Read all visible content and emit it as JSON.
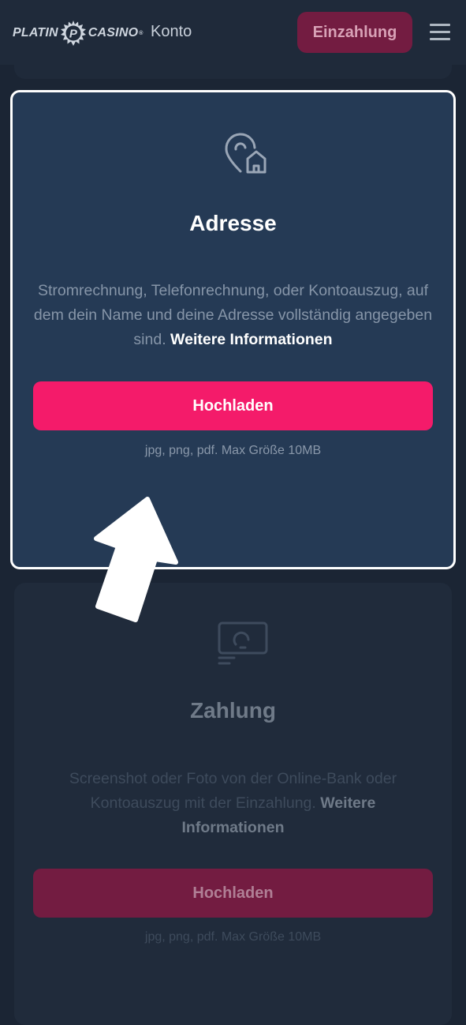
{
  "header": {
    "logo_left": "PLATIN",
    "logo_emblem_letter": "P",
    "logo_right": "CASINO",
    "logo_tm": "®",
    "nav_konto": "Konto",
    "deposit_button": "Einzahlung",
    "menu_icon": "hamburger-menu-icon"
  },
  "cards": {
    "adresse": {
      "icon": "location-home-icon",
      "title": "Adresse",
      "description": "Stromrechnung, Telefonrechnung, oder Kontoauszug, auf dem dein Name und deine Adresse vollständig angegeben sind.",
      "more_link": "Weitere Informationen",
      "upload_button": "Hochladen",
      "note": "jpg, png, pdf. Max Größe 10MB"
    },
    "zahlung": {
      "icon": "payment-card-icon",
      "title": "Zahlung",
      "description": "Screenshot oder Foto von der Online-Bank oder Kontoauszug mit der Einzahlung.",
      "more_link": "Weitere Informationen",
      "upload_button": "Hochladen",
      "note": "jpg, png, pdf. Max Größe 10MB"
    }
  },
  "overlay": {
    "arrow_icon": "arrow-up-pointer-icon"
  },
  "colors": {
    "background": "#1b2534",
    "header": "#1f2a3a",
    "card_active": "#253a55",
    "card_dimmed": "#202b3b",
    "accent_pink": "#f41b6a",
    "accent_pink_dimmed": "#731c41",
    "highlight_border": "#ffffff"
  }
}
